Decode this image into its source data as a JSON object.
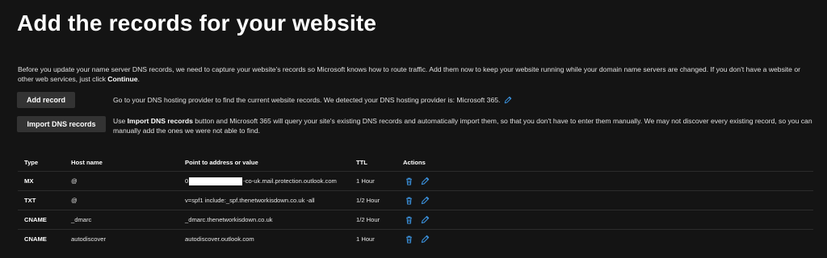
{
  "page": {
    "title": "Add the records for your website",
    "intro_text": "Before you update your name server DNS records, we need to capture your website's records so Microsoft knows how to route traffic. Add them now to keep your website running while your domain name servers are changed. If you don't have a website or other web services, just click ",
    "intro_bold": "Continue",
    "intro_end": "."
  },
  "actions": {
    "add_record_label": "Add record",
    "add_record_desc": "Go to your DNS hosting provider to find the current website records. We detected your DNS hosting provider is: Microsoft 365.",
    "import_label": "Import DNS records",
    "import_desc_prefix": "Use ",
    "import_desc_bold": "Import DNS records",
    "import_desc_rest": " button and Microsoft 365 will query your site's existing DNS records and automatically import them, so that you don't have to enter them manually. We may not discover every existing record, so you can manually add the ones we were not able to find."
  },
  "table": {
    "headers": {
      "type": "Type",
      "host": "Host name",
      "point": "Point to address or value",
      "ttl": "TTL",
      "actions": "Actions"
    },
    "rows": [
      {
        "type": "MX",
        "host": "@",
        "point_prefix": "0",
        "point": "-co-uk.mail.protection.outlook.com",
        "ttl": "1 Hour"
      },
      {
        "type": "TXT",
        "host": "@",
        "point_prefix": "",
        "point": "v=spf1 include:_spf.thenetworkisdown.co.uk -all",
        "ttl": "1/2 Hour"
      },
      {
        "type": "CNAME",
        "host": "_dmarc",
        "point_prefix": "",
        "point": "_dmarc.thenetworkisdown.co.uk",
        "ttl": "1/2 Hour"
      },
      {
        "type": "CNAME",
        "host": "autodiscover",
        "point_prefix": "",
        "point": "autodiscover.outlook.com",
        "ttl": "1 Hour"
      }
    ]
  },
  "icons": {
    "edit": "pencil-icon",
    "delete": "trash-icon",
    "accent": "#3a8fd9"
  }
}
